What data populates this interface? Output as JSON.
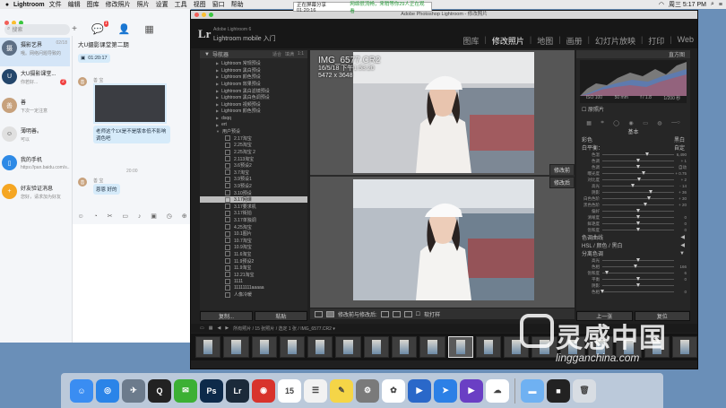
{
  "menubar": {
    "app": "Lightroom",
    "menus": [
      "文件",
      "编辑",
      "图库",
      "修改照片",
      "照片",
      "设置",
      "工具",
      "视图",
      "窗口",
      "帮助"
    ],
    "clock": "周三 5:17 PM"
  },
  "recording": {
    "text": "正在屏幕分享 01:20:16",
    "status": "网络很流畅，来稍等你29人正在观看"
  },
  "qq": {
    "search_placeholder": "搜索",
    "message_badge": "1",
    "contacts": [
      {
        "name": "摄影艺界",
        "preview": "哦。网络问题导致的",
        "time": "02/18"
      },
      {
        "name": "大U摄影课堂...",
        "preview": "你若好...",
        "time": "",
        "unread": "2"
      },
      {
        "name": "善",
        "preview": "下次一定注意",
        "time": ""
      },
      {
        "name": "薄明善。",
        "preview": "可以",
        "time": ""
      },
      {
        "name": "我的手机",
        "preview": "https://pan.baidu.com/s...",
        "time": ""
      },
      {
        "name": "好友验证消息",
        "preview": "您好，请求加为好友",
        "time": ""
      }
    ],
    "chat": {
      "title": "大U摄影课堂第二期",
      "time1": "01:20:17",
      "sender": "善 宝",
      "question": "老师这个1X是不是版本低不影响调色吧",
      "time2": "20:00",
      "reply_sender": "善 宝",
      "reply": "恩恩 好的"
    }
  },
  "lightroom": {
    "window_title": "Adobe Photoshop Lightroom - 修改照片",
    "logo": "Lr",
    "brand_top": "Adobe Lightroom 6",
    "brand_name": "Lightroom mobile 入门",
    "modules": [
      "图库",
      "修改照片",
      "地图",
      "画册",
      "幻灯片放映",
      "打印",
      "Web"
    ],
    "left_panel": {
      "navigator": "导航器",
      "nav_opts": [
        "适合",
        "填满",
        "1:1"
      ],
      "presets": [
        {
          "label": "Lightroom 常规预设",
          "kind": "folder"
        },
        {
          "label": "Lightroom 黑白预设",
          "kind": "folder"
        },
        {
          "label": "Lightroom 颜色预设",
          "kind": "folder"
        },
        {
          "label": "Lightroom 效果预设",
          "kind": "folder"
        },
        {
          "label": "Lightroom 黑白滤镜预设",
          "kind": "folder"
        },
        {
          "label": "Lightroom 黑白色调预设",
          "kind": "folder"
        },
        {
          "label": "Lightroom 视频预设",
          "kind": "folder"
        },
        {
          "label": "Lightroom 颜色预设",
          "kind": "folder"
        },
        {
          "label": "dsqq",
          "kind": "folder"
        },
        {
          "label": "ert",
          "kind": "folder"
        },
        {
          "label": "用户预设",
          "kind": "open"
        },
        {
          "label": "2.17淘宝",
          "kind": "item"
        },
        {
          "label": "2.25淘宝",
          "kind": "item"
        },
        {
          "label": "2.25淘宝 2",
          "kind": "item"
        },
        {
          "label": "2.113淘宝",
          "kind": "item"
        },
        {
          "label": "3.6预设2",
          "kind": "item"
        },
        {
          "label": "3.7淘宝",
          "kind": "item"
        },
        {
          "label": "3.9预设1",
          "kind": "item"
        },
        {
          "label": "3.9预设2",
          "kind": "item"
        },
        {
          "label": "3.10预设",
          "kind": "item"
        },
        {
          "label": "3.17网课",
          "kind": "item",
          "selected": true
        },
        {
          "label": "3.17要求机",
          "kind": "item"
        },
        {
          "label": "3.17街拍",
          "kind": "item"
        },
        {
          "label": "3.17单独调",
          "kind": "item"
        },
        {
          "label": "4.25淘宝",
          "kind": "item"
        },
        {
          "label": "10.1图片",
          "kind": "item"
        },
        {
          "label": "10.7淘宝",
          "kind": "item"
        },
        {
          "label": "10.9淘宝",
          "kind": "item"
        },
        {
          "label": "11.6淘宝",
          "kind": "item"
        },
        {
          "label": "11.9预设2",
          "kind": "item"
        },
        {
          "label": "11.9淘宝",
          "kind": "item"
        },
        {
          "label": "12.21淘宝",
          "kind": "item"
        },
        {
          "label": "1111",
          "kind": "item"
        },
        {
          "label": "11111111aaaaa",
          "kind": "item"
        },
        {
          "label": "人像冷暖",
          "kind": "item"
        }
      ],
      "copy_btn": "复制...",
      "paste_btn": "粘贴"
    },
    "photo": {
      "filename": "IMG_6577.CR2",
      "datetime": "16/5/18 下午1:53:20",
      "dimensions": "5472 x 3648",
      "before_label": "修改前",
      "after_label": "修改后"
    },
    "toolbar": {
      "mode": "修改前与修改后:",
      "soft_proof": "软打样"
    },
    "right_panel": {
      "histogram": "直方图",
      "histo_info": [
        "ISO 100",
        "50 mm",
        "f / 1.8",
        "1/200 秒"
      ],
      "orig_photo": "原照片",
      "basic": "基本",
      "treatment_color": "彩色",
      "treatment_bw": "黑白",
      "wb_label": "白平衡：",
      "wb_value": "自定",
      "sliders": [
        {
          "label": "色温",
          "value": "6,490",
          "pos": 0.62
        },
        {
          "label": "色调",
          "value": "+ 1",
          "pos": 0.5
        },
        {
          "label": "色调",
          "value": "自动",
          "pos": 0.5
        },
        {
          "label": "曝光度",
          "value": "+ 0.75",
          "pos": 0.57
        },
        {
          "label": "对比度",
          "value": "+ 2",
          "pos": 0.51
        },
        {
          "label": "高光",
          "value": "- 14",
          "pos": 0.43
        },
        {
          "label": "阴影",
          "value": "+ 36",
          "pos": 0.68
        },
        {
          "label": "白色色阶",
          "value": "+ 30",
          "pos": 0.65
        },
        {
          "label": "黑色色阶",
          "value": "+ 20",
          "pos": 0.6
        },
        {
          "label": "偏好",
          "value": "",
          "pos": 0.5
        },
        {
          "label": "清晰度",
          "value": "0",
          "pos": 0.5
        },
        {
          "label": "鲜艳度",
          "value": "0",
          "pos": 0.5
        },
        {
          "label": "饱和度",
          "value": "0",
          "pos": 0.5
        }
      ],
      "tone_curve": "色调曲线",
      "hsl": "HSL / 颜色 / 黑白",
      "split_toning": "分离色调",
      "split_sliders": [
        {
          "label": "高光",
          "value": "",
          "pos": 0.5
        },
        {
          "label": "色相",
          "value": "166",
          "pos": 0.46
        },
        {
          "label": "饱和度",
          "value": "6",
          "pos": 0.06
        },
        {
          "label": "平衡",
          "value": "0",
          "pos": 0.5
        },
        {
          "label": "阴影",
          "value": "",
          "pos": 0.5
        },
        {
          "label": "色相",
          "value": "0",
          "pos": 0.0
        }
      ],
      "prev_btn": "上一张",
      "reset_btn": "复位"
    },
    "filmbar": {
      "path": "所有照片 / 15 张照片 / 选定 1 张 / IMG_6577.CR2 ▾"
    },
    "thumbnails": 18,
    "selected_thumb": 9
  },
  "watermark": {
    "cn": "灵感中国",
    "en": "lingganchina.com"
  },
  "dock": [
    {
      "name": "finder-icon",
      "color": "#3a8df2",
      "glyph": "☺"
    },
    {
      "name": "safari-icon",
      "color": "#2a84e8",
      "glyph": "◎"
    },
    {
      "name": "launchpad-icon",
      "color": "#6c7b8c",
      "glyph": "✈"
    },
    {
      "name": "qq-icon",
      "color": "#222222",
      "glyph": "Q"
    },
    {
      "name": "wechat-icon",
      "color": "#3cb034",
      "glyph": "✉"
    },
    {
      "name": "photoshop-icon",
      "color": "#0d2a4a",
      "glyph": "Ps"
    },
    {
      "name": "lightroom-icon",
      "color": "#1b2a3a",
      "glyph": "Lr"
    },
    {
      "name": "netease-music-icon",
      "color": "#d8332c",
      "glyph": "◉"
    },
    {
      "name": "calendar-icon",
      "color": "#ffffff",
      "glyph": "15"
    },
    {
      "name": "reminders-icon",
      "color": "#f2f2f2",
      "glyph": "☰"
    },
    {
      "name": "notes-icon",
      "color": "#f5d547",
      "glyph": "✎"
    },
    {
      "name": "system-preferences-icon",
      "color": "#7a7a7a",
      "glyph": "⚙"
    },
    {
      "name": "photos-icon",
      "color": "#ffffff",
      "glyph": "✿"
    },
    {
      "name": "video-editor-icon",
      "color": "#2a68c9",
      "glyph": "▶"
    },
    {
      "name": "feishu-icon",
      "color": "#2c80e6",
      "glyph": "➤"
    },
    {
      "name": "media-player-icon",
      "color": "#6a3fc4",
      "glyph": "▶"
    },
    {
      "name": "baidu-netdisk-icon",
      "color": "#ffffff",
      "glyph": "☁"
    },
    {
      "name": "folder-icon",
      "color": "#6fb1f2",
      "glyph": "▬"
    },
    {
      "name": "screen-record-icon",
      "color": "#222222",
      "glyph": "■"
    },
    {
      "name": "trash-icon",
      "color": "#d8dde3",
      "glyph": "🗑"
    }
  ]
}
